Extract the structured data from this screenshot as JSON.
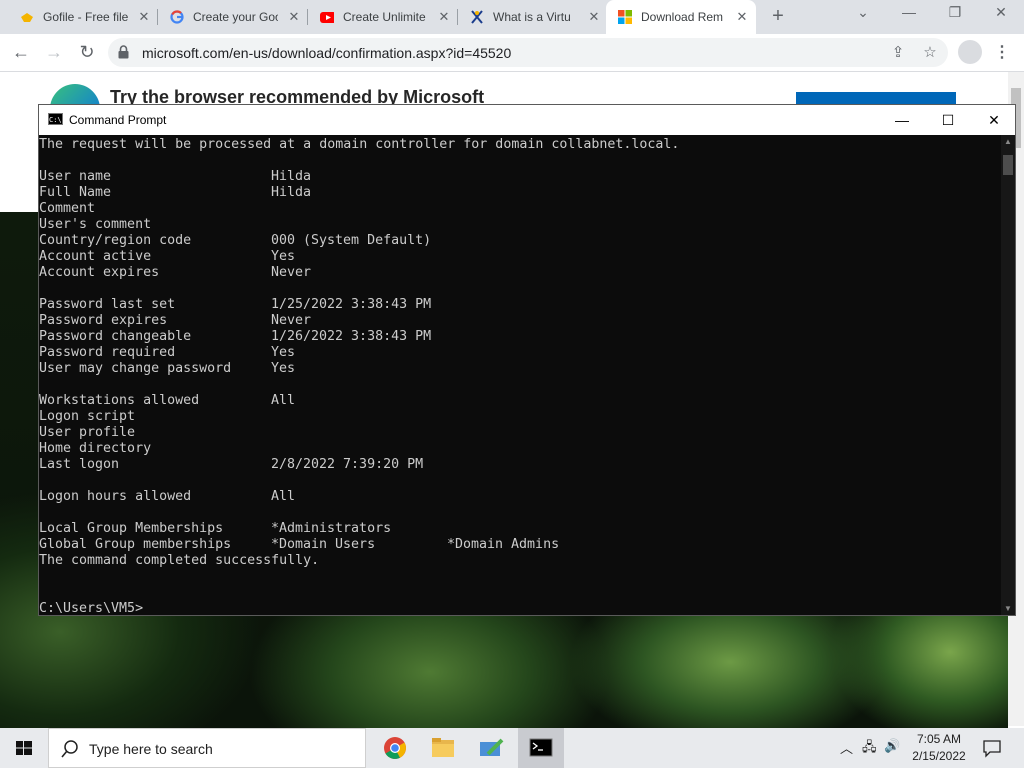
{
  "browser": {
    "tabs": [
      {
        "title": "Gofile - Free file",
        "icon": "gofile-icon"
      },
      {
        "title": "Create your Goo",
        "icon": "google-icon"
      },
      {
        "title": "Create Unlimite",
        "icon": "youtube-icon"
      },
      {
        "title": "What is a Virtu",
        "icon": "x-logo-icon"
      },
      {
        "title": "Download Rem",
        "icon": "microsoft-icon",
        "active": true
      }
    ],
    "url": "microsoft.com/en-us/download/confirmation.aspx?id=45520"
  },
  "page": {
    "banner": "Try the browser recommended by Microsoft"
  },
  "cmd": {
    "title": "Command Prompt",
    "lines": [
      {
        "label": "The request will be processed at a domain controller for domain collabnet.local.",
        "value": ""
      },
      {
        "label": "",
        "value": ""
      },
      {
        "label": "User name",
        "value": "Hilda"
      },
      {
        "label": "Full Name",
        "value": "Hilda"
      },
      {
        "label": "Comment",
        "value": ""
      },
      {
        "label": "User's comment",
        "value": ""
      },
      {
        "label": "Country/region code",
        "value": "000 (System Default)"
      },
      {
        "label": "Account active",
        "value": "Yes"
      },
      {
        "label": "Account expires",
        "value": "Never"
      },
      {
        "label": "",
        "value": ""
      },
      {
        "label": "Password last set",
        "value": "1/25/2022 3:38:43 PM"
      },
      {
        "label": "Password expires",
        "value": "Never"
      },
      {
        "label": "Password changeable",
        "value": "1/26/2022 3:38:43 PM"
      },
      {
        "label": "Password required",
        "value": "Yes"
      },
      {
        "label": "User may change password",
        "value": "Yes"
      },
      {
        "label": "",
        "value": ""
      },
      {
        "label": "Workstations allowed",
        "value": "All"
      },
      {
        "label": "Logon script",
        "value": ""
      },
      {
        "label": "User profile",
        "value": ""
      },
      {
        "label": "Home directory",
        "value": ""
      },
      {
        "label": "Last logon",
        "value": "2/8/2022 7:39:20 PM"
      },
      {
        "label": "",
        "value": ""
      },
      {
        "label": "Logon hours allowed",
        "value": "All"
      },
      {
        "label": "",
        "value": ""
      },
      {
        "label": "Local Group Memberships",
        "value": "*Administrators"
      },
      {
        "label": "Global Group memberships",
        "value": "*Domain Users",
        "value2": "*Domain Admins"
      },
      {
        "label": "The command completed successfully.",
        "value": ""
      },
      {
        "label": "",
        "value": ""
      },
      {
        "label": "",
        "value": ""
      },
      {
        "label": "C:\\Users\\VM5>",
        "value": ""
      }
    ]
  },
  "taskbar": {
    "search_placeholder": "Type here to search",
    "time": "7:05 AM",
    "date": "2/15/2022"
  }
}
